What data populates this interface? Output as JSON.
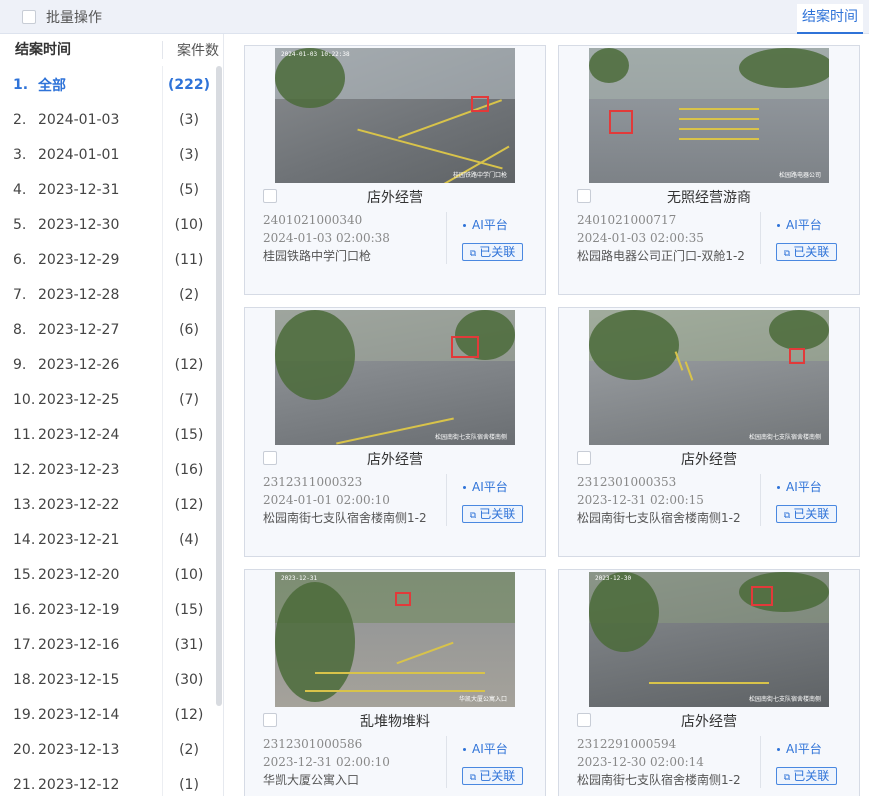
{
  "topbar": {
    "batch_label": "批量操作",
    "tab_label": "结案时间"
  },
  "sidebar": {
    "col_time": "结案时间",
    "col_count": "案件数",
    "items": [
      {
        "idx": "1.",
        "date": "全部",
        "count": "(222)",
        "active": true
      },
      {
        "idx": "2.",
        "date": "2024-01-03",
        "count": "(3)"
      },
      {
        "idx": "3.",
        "date": "2024-01-01",
        "count": "(3)"
      },
      {
        "idx": "4.",
        "date": "2023-12-31",
        "count": "(5)"
      },
      {
        "idx": "5.",
        "date": "2023-12-30",
        "count": "(10)"
      },
      {
        "idx": "6.",
        "date": "2023-12-29",
        "count": "(11)"
      },
      {
        "idx": "7.",
        "date": "2023-12-28",
        "count": "(2)"
      },
      {
        "idx": "8.",
        "date": "2023-12-27",
        "count": "(6)"
      },
      {
        "idx": "9.",
        "date": "2023-12-26",
        "count": "(12)"
      },
      {
        "idx": "10.",
        "date": "2023-12-25",
        "count": "(7)"
      },
      {
        "idx": "11.",
        "date": "2023-12-24",
        "count": "(15)"
      },
      {
        "idx": "12.",
        "date": "2023-12-23",
        "count": "(16)"
      },
      {
        "idx": "13.",
        "date": "2023-12-22",
        "count": "(12)"
      },
      {
        "idx": "14.",
        "date": "2023-12-21",
        "count": "(4)"
      },
      {
        "idx": "15.",
        "date": "2023-12-20",
        "count": "(10)"
      },
      {
        "idx": "16.",
        "date": "2023-12-19",
        "count": "(15)"
      },
      {
        "idx": "17.",
        "date": "2023-12-16",
        "count": "(31)"
      },
      {
        "idx": "18.",
        "date": "2023-12-15",
        "count": "(30)"
      },
      {
        "idx": "19.",
        "date": "2023-12-14",
        "count": "(12)"
      },
      {
        "idx": "20.",
        "date": "2023-12-13",
        "count": "(2)"
      },
      {
        "idx": "21.",
        "date": "2023-12-12",
        "count": "(1)"
      }
    ]
  },
  "cards": [
    {
      "title": "店外经营",
      "id": "2401021000340",
      "time": "2024-01-03 02:00:38",
      "location": "桂园铁路中学门口枪",
      "source": "AI平台",
      "status": "已关联",
      "scene": "street",
      "watermark": "桂园铁路中学门口枪",
      "stamp": "2024-01-03 10:22:38"
    },
    {
      "title": "无照经营游商",
      "id": "2401021000717",
      "time": "2024-01-03 02:00:35",
      "location": "松园路电器公司正门口-双舱1-2",
      "source": "AI平台",
      "status": "已关联",
      "scene": "crossing",
      "watermark": "松园路电器公司",
      "stamp": ""
    },
    {
      "title": "店外经营",
      "id": "2312311000323",
      "time": "2024-01-01 02:00:10",
      "location": "松园南街七支队宿舍楼南侧1-2",
      "source": "AI平台",
      "status": "已关联",
      "scene": "shade",
      "watermark": "松园南街七支队宿舍楼南侧",
      "stamp": ""
    },
    {
      "title": "店外经营",
      "id": "2312301000353",
      "time": "2023-12-31 02:00:15",
      "location": "松园南街七支队宿舍楼南侧1-2",
      "source": "AI平台",
      "status": "已关联",
      "scene": "shade2",
      "watermark": "松园南街七支队宿舍楼南侧",
      "stamp": ""
    },
    {
      "title": "乱堆物堆料",
      "id": "2312301000586",
      "time": "2023-12-31 02:00:10",
      "location": "华凯大厦公寓入口",
      "source": "AI平台",
      "status": "已关联",
      "scene": "alley",
      "watermark": "华凯大厦公寓入口",
      "stamp": "2023-12-31"
    },
    {
      "title": "店外经营",
      "id": "2312291000594",
      "time": "2023-12-30 02:00:14",
      "location": "松园南街七支队宿舍楼南侧1-2",
      "source": "AI平台",
      "status": "已关联",
      "scene": "shade3",
      "watermark": "松园南街七支队宿舍楼南侧",
      "stamp": "2023-12-30"
    }
  ],
  "colors": {
    "accent": "#2f73d8",
    "detect_box": "#e23a3a"
  }
}
